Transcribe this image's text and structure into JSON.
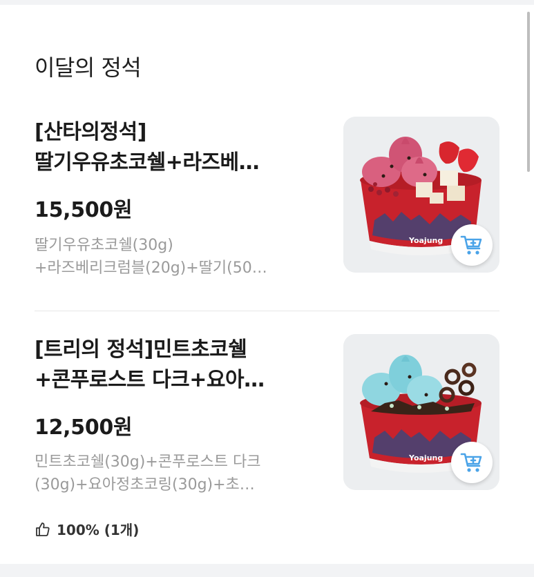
{
  "section": {
    "title": "이달의 정석"
  },
  "items": [
    {
      "name_line1": "[산타의정석]",
      "name_line2": "딸기우유초코쉘+라즈베…",
      "price": "15,500원",
      "desc_line1": "딸기우유초코쉘(30g)",
      "desc_line2": "+라즈베리크럼블(20g)+딸기(50…",
      "image": "strawberry-froyo-bowl",
      "cart_icon": "cart-add-icon"
    },
    {
      "name_line1": "[트리의 정석]민트초코쉘",
      "name_line2": "+콘푸로스트 다크+요아…",
      "price": "12,500원",
      "desc_line1": "민트초코쉘(30g)+콘푸로스트 다크",
      "desc_line2": "(30g)+요아정초코링(30g)+초…",
      "image": "mint-choco-froyo-bowl",
      "cart_icon": "cart-add-icon",
      "rating": {
        "icon": "thumbs-up-icon",
        "text": "100% (1개)"
      }
    }
  ],
  "colors": {
    "accent": "#4aa3e8",
    "cup_red": "#c8222c"
  }
}
